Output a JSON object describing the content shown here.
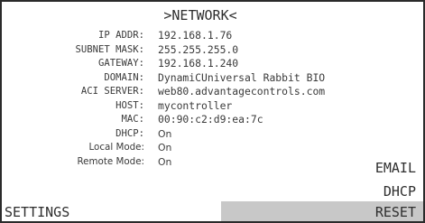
{
  "title": ">NETWORK<",
  "fields": [
    {
      "label": "IP ADDR:",
      "value": "192.168.1.76"
    },
    {
      "label": "SUBNET MASK:",
      "value": "255.255.255.0"
    },
    {
      "label": "GATEWAY:",
      "value": "192.168.1.240"
    },
    {
      "label": "DOMAIN:",
      "value": "DynamiCUniversal Rabbit BIO"
    },
    {
      "label": "ACI SERVER:",
      "value": "web80.advantagecontrols.com"
    },
    {
      "label": "HOST:",
      "value": "mycontroller"
    },
    {
      "label": "MAC:",
      "value": "00:90:c2:d9:ea:7c"
    },
    {
      "label": "DHCP:",
      "value": "On"
    },
    {
      "label": "Local Mode:",
      "value": "On"
    },
    {
      "label": "Remote Mode:",
      "value": "On"
    }
  ],
  "softkeys": {
    "email": "EMAIL",
    "dhcp": "DHCP",
    "settings": "SETTINGS",
    "reset": "RESET"
  }
}
